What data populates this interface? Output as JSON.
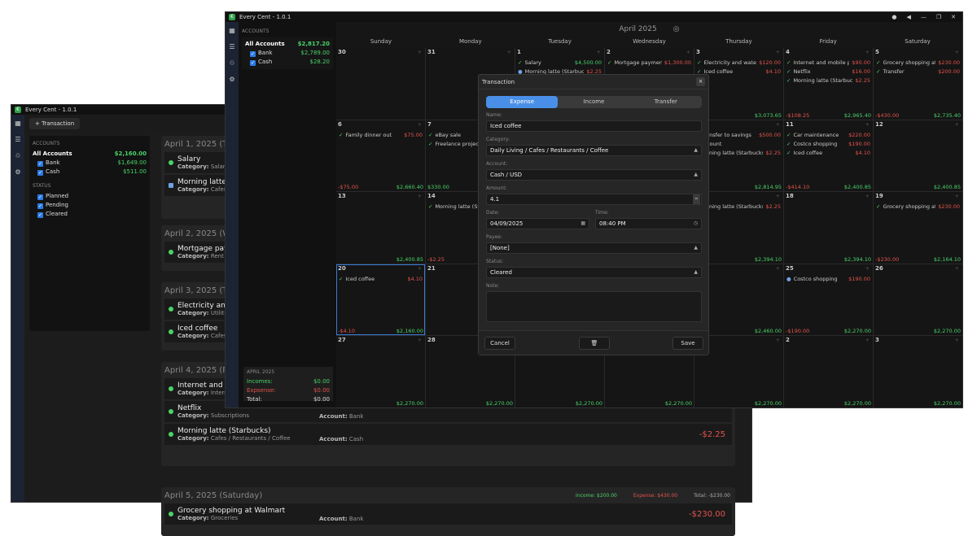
{
  "back": {
    "title": "Every Cent - 1.0.1",
    "add_transaction": "+ Transaction",
    "accounts_label": "ACCOUNTS",
    "accounts": [
      {
        "name": "All Accounts",
        "amount": "$2,160.00"
      },
      {
        "name": "Bank",
        "amount": "$1,649.00"
      },
      {
        "name": "Cash",
        "amount": "$511.00"
      }
    ],
    "status_label": "STATUS",
    "statuses": [
      "Planned",
      "Pending",
      "Cleared"
    ],
    "days": [
      {
        "date": "April 1, 2025 (Tuesd",
        "txns": [
          {
            "name": "Salary",
            "cat_label": "Category:",
            "cat": "Salary"
          },
          {
            "name": "Morning latte (Starb",
            "cat_label": "Category:",
            "cat": "Cafes / Resta"
          }
        ]
      },
      {
        "date": "April 2, 2025 (Wedne",
        "txns": [
          {
            "name": "Mortgage payment",
            "cat_label": "Category:",
            "cat": "Rent / Mortg"
          }
        ]
      },
      {
        "date": "April 3, 2025 (Thursd",
        "txns": [
          {
            "name": "Electricity and wate",
            "cat_label": "Category:",
            "cat": "Utilities"
          },
          {
            "name": "Iced coffee",
            "cat_label": "Category:",
            "cat": "Cafes / Restau"
          }
        ]
      },
      {
        "date": "April 4, 2025 (Friday)",
        "txns": [
          {
            "name": "Internet and mobile",
            "cat_label": "Category:",
            "cat": "Internet"
          },
          {
            "name": "Netflix",
            "cat_label": "Category:",
            "cat": "Subscriptions"
          },
          {
            "name": "Morning latte (Starbucks)",
            "cat_label": "Category:",
            "cat": "Cafes / Restaurants / Coffee",
            "acc_label": "Account:",
            "acc": "Cash",
            "amount": "-$2.25"
          }
        ]
      },
      {
        "date": "April 5, 2025 (Saturday)",
        "income": "Income: $200.00",
        "expense": "Expense: $430.00",
        "total": "Total: -$230.00",
        "txns": [
          {
            "name": "Grocery shopping at Walmart",
            "cat_label": "Category:",
            "cat": "Groceries",
            "acc_label": "Account:",
            "acc": "Bank",
            "amount": "-$230.00"
          }
        ]
      }
    ],
    "netflix_acc_label": "Account:",
    "netflix_acc": "Bank"
  },
  "front": {
    "title": "Every Cent - 1.0.1",
    "month": "April 2025",
    "accounts_label": "ACCOUNTS",
    "accounts": [
      {
        "name": "All Accounts",
        "amount": "$2,817.20"
      },
      {
        "name": "Bank",
        "amount": "$2,789.00"
      },
      {
        "name": "Cash",
        "amount": "$28.20"
      }
    ],
    "summary": {
      "head": "APRIL 2025",
      "incomes_l": "Incomes:",
      "incomes": "$0.00",
      "expenses_l": "Expsense:",
      "expenses": "$0.00",
      "total_l": "Total:",
      "total": "$0.00"
    },
    "weekdays": [
      "Sunday",
      "Monday",
      "Tuesday",
      "Wednesday",
      "Thursday",
      "Friday",
      "Saturday"
    ],
    "cells": [
      {
        "d": "30",
        "items": [],
        "fl": "",
        "fr": ""
      },
      {
        "d": "31",
        "items": [],
        "fl": "",
        "fr": ""
      },
      {
        "d": "1",
        "items": [
          {
            "n": "Salary",
            "a": "$4,500.00",
            "g": true
          },
          {
            "n": "Morning latte (Starbucks)",
            "a": "$2.25",
            "dot": true
          }
        ],
        "fl": "",
        "fr": ""
      },
      {
        "d": "2",
        "items": [
          {
            "n": "Mortgage payment",
            "a": "$1,300.00"
          }
        ],
        "fl": "",
        "fr": ""
      },
      {
        "d": "3",
        "items": [
          {
            "n": "Electricity and water bill",
            "a": "$120.00"
          },
          {
            "n": "Iced coffee",
            "a": "$4.10"
          }
        ],
        "fl": ".10",
        "fr": "$3,073.65"
      },
      {
        "d": "4",
        "items": [
          {
            "n": "Internet and mobile plan",
            "a": "$90.00"
          },
          {
            "n": "Netflix",
            "a": "$16.00"
          },
          {
            "n": "Morning latte (Starbucks)",
            "a": "$2.25"
          }
        ],
        "fl": "-$108.25",
        "fr": "$2,965.40"
      },
      {
        "d": "5",
        "items": [
          {
            "n": "Grocery shopping at Walmart",
            "a": "$230.00"
          },
          {
            "n": "Transfer",
            "a": "$200.00"
          }
        ],
        "fl": "-$430.00",
        "fr": "$2,735.40"
      },
      {
        "d": "6",
        "items": [
          {
            "n": "Family dinner out",
            "a": "$75.00"
          }
        ],
        "fl": "-$75.00",
        "fr": "$2,660.40"
      },
      {
        "d": "7",
        "items": [
          {
            "n": "eBay sale",
            "a": "",
            "g": true
          },
          {
            "n": "Freelance project",
            "a": ""
          }
        ],
        "fl": "$330.00",
        "fr": ""
      },
      {
        "d": "",
        "items": [],
        "fl": "",
        "fr": ""
      },
      {
        "d": "",
        "items": [],
        "fl": "",
        "fr": ""
      },
      {
        "d": "",
        "items": [
          {
            "n": "ransfer to savings",
            "a": "$500.00"
          },
          {
            "n": "ccount",
            "a": ""
          },
          {
            "n": "orning latte (Starbucks)",
            "a": "$2.25"
          }
        ],
        "fl": ".25",
        "fr": "$2,814.95"
      },
      {
        "d": "11",
        "items": [
          {
            "n": "Car maintenance",
            "a": "$220.00"
          },
          {
            "n": "Costco shopping",
            "a": "$190.00"
          },
          {
            "n": "Iced coffee",
            "a": "$4.10"
          }
        ],
        "fl": "-$414.10",
        "fr": "$2,400.85"
      },
      {
        "d": "12",
        "items": [],
        "fl": "",
        "fr": "$2,400.85"
      },
      {
        "d": "13",
        "items": [],
        "fl": "",
        "fr": "$2,400.85"
      },
      {
        "d": "14",
        "items": [
          {
            "n": "Morning latte (Sta",
            "a": ""
          }
        ],
        "fl": "-$2.25",
        "fr": ""
      },
      {
        "d": "",
        "items": [],
        "fl": "",
        "fr": ""
      },
      {
        "d": "",
        "items": [],
        "fl": "",
        "fr": ""
      },
      {
        "d": "",
        "items": [
          {
            "n": "orning latte (Starbucks)",
            "a": "$2.25"
          }
        ],
        "fl": "",
        "fr": "$2,394.10"
      },
      {
        "d": "18",
        "items": [],
        "fl": "",
        "fr": "$2,394.10"
      },
      {
        "d": "19",
        "items": [
          {
            "n": "Grocery shopping at Walmart",
            "a": "$230.00"
          }
        ],
        "fl": "-$230.00",
        "fr": "$2,164.10"
      },
      {
        "d": "20",
        "sel": true,
        "items": [
          {
            "n": "Iced coffee",
            "a": "$4.10"
          }
        ],
        "fl": "-$4.10",
        "fr": "$2,160.00"
      },
      {
        "d": "21",
        "items": [],
        "fl": "",
        "fr": ""
      },
      {
        "d": "",
        "items": [],
        "fl": "",
        "fr": ""
      },
      {
        "d": "",
        "items": [],
        "fl": "",
        "fr": ""
      },
      {
        "d": "",
        "items": [],
        "fl": "",
        "fr": "$2,460.00"
      },
      {
        "d": "25",
        "items": [
          {
            "n": "Costco shopping",
            "a": "$190.00",
            "dot": true
          }
        ],
        "fl": "-$190.00",
        "fr": "$2,270.00"
      },
      {
        "d": "26",
        "items": [],
        "fl": "",
        "fr": "$2,270.00"
      },
      {
        "d": "27",
        "items": [],
        "fl": "",
        "fr": "$2,270.00"
      },
      {
        "d": "28",
        "items": [],
        "fl": "",
        "fr": "$2,270.00"
      },
      {
        "d": "",
        "items": [],
        "fl": "",
        "fr": "$2,270.00"
      },
      {
        "d": "",
        "items": [],
        "fl": "",
        "fr": "$2,270.00"
      },
      {
        "d": "",
        "items": [],
        "fl": "",
        "fr": "$2,270.00"
      },
      {
        "d": "2",
        "items": [],
        "fl": "",
        "fr": "$2,270.00"
      },
      {
        "d": "3",
        "items": [],
        "fl": "",
        "fr": "$2,270.00"
      }
    ]
  },
  "modal": {
    "title": "Transaction",
    "close": "×",
    "tabs": [
      "Expense",
      "Income",
      "Transfer"
    ],
    "name_label": "Name:",
    "name": "Iced coffee",
    "category_label": "Category:",
    "category": "Daily Living  /  Cafes / Restaurants / Coffee",
    "account_label": "Account:",
    "account": "Cash / USD",
    "amount_label": "Amount:",
    "amount": "4.1",
    "date_label": "Date:",
    "date": "04/09/2025",
    "time_label": "Time:",
    "time": "08:40 PM",
    "payee_label": "Payee:",
    "payee": "[None]",
    "status_label": "Status:",
    "status": "Cleared",
    "note_label": "Note:",
    "cancel": "Cancel",
    "save": "Save"
  }
}
